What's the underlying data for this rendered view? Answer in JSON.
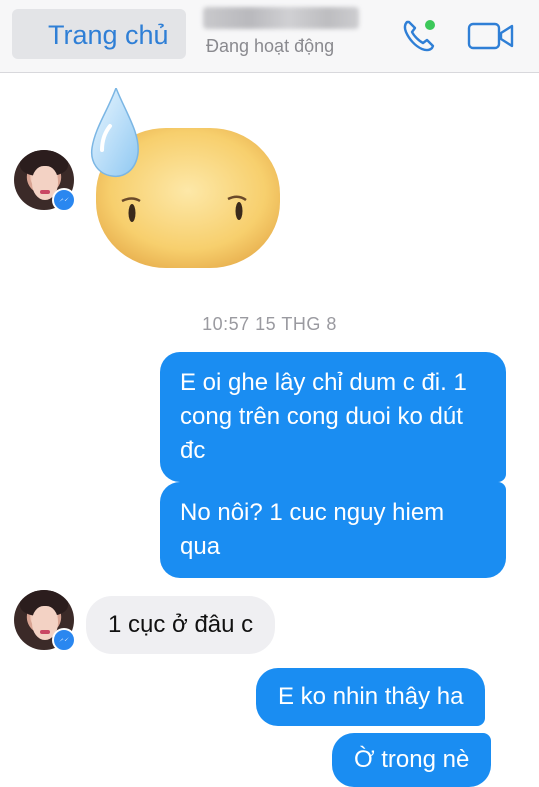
{
  "header": {
    "back_label": "Trang chủ",
    "status": "Đang hoạt động",
    "icons": {
      "call": "phone-icon",
      "video": "video-camera-icon",
      "back": "chevron-left-icon"
    },
    "accent_color": "#2f7fd6",
    "online_color": "#3cc85a"
  },
  "conversation": {
    "sticker": "sweat-drop-face-sticker",
    "timestamp": "10:57 15 THG 8",
    "messages": [
      {
        "from": "me",
        "text": "E oi ghe lây chỉ dum c đi. 1 cong trên cong duoi ko dút đc"
      },
      {
        "from": "me",
        "text": "No nôi? 1 cuc nguy hiem qua"
      },
      {
        "from": "them",
        "text": "1 cục ở đâu c"
      },
      {
        "from": "me",
        "text": "E ko nhin thây ha"
      },
      {
        "from": "me",
        "text": "Ờ trong nè"
      }
    ],
    "bubble_color_out": "#1a8df2",
    "bubble_color_in": "#efeff2"
  }
}
